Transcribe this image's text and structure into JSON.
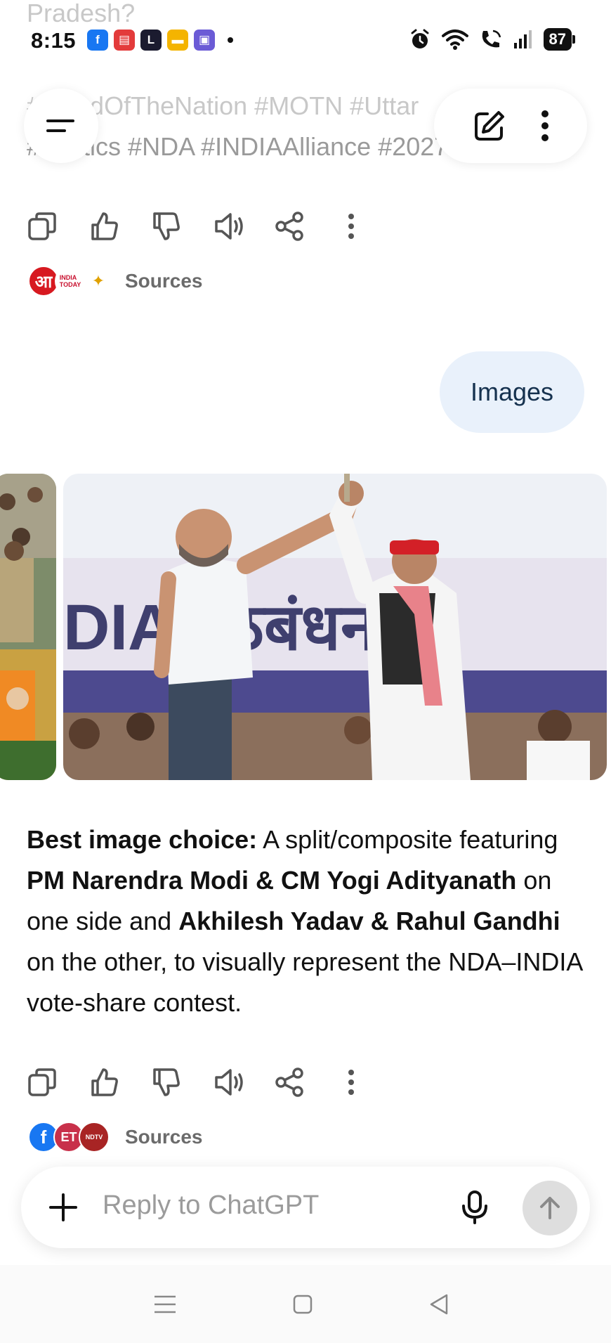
{
  "status_bar": {
    "time": "8:15",
    "battery": "87",
    "app_icons": [
      {
        "name": "facebook-app-icon",
        "glyph": "f",
        "color": "#1877f2"
      },
      {
        "name": "news-app-icon",
        "glyph": "▤",
        "color": "#e33b3b"
      },
      {
        "name": "news-l-app-icon",
        "glyph": "L",
        "color": "#1b1b2f"
      },
      {
        "name": "notes-app-icon",
        "glyph": "▬",
        "color": "#f4b400"
      },
      {
        "name": "gallery-app-icon",
        "glyph": "▣",
        "color": "#6b5bd6"
      }
    ]
  },
  "faded_text": {
    "line1": "Pradesh?",
    "line2": "#MoodOfTheNation #MOTN #Uttar",
    "line3": "#Politics #NDA #INDIAAlliance #2027"
  },
  "actions": {
    "copy": "copy-icon",
    "like": "thumbs-up-icon",
    "dislike": "thumbs-down-icon",
    "read_aloud": "speaker-icon",
    "share": "share-icon",
    "more": "more-vertical-icon"
  },
  "sources_top": {
    "label": "Sources",
    "logos": [
      {
        "name": "aaj-tak-logo",
        "text": "आ",
        "color": "#d71920"
      },
      {
        "name": "india-today-logo",
        "text": "INDIA TODAY",
        "color": "#c8102e"
      },
      {
        "name": "national-poster-logo",
        "text": "✦",
        "color": "#e0a100"
      }
    ]
  },
  "user_message": "Images",
  "answer": {
    "seg1_bold": "Best image choice:",
    "seg2": " A split/composite featuring ",
    "seg3_bold": "PM Narendra Modi & CM Yogi Adityanath",
    "seg4": " on one side and ",
    "seg5_bold": "Akhilesh Yadav & Rahul Gandhi",
    "seg6": " on the other, to visually represent the NDA–INDIA vote-share contest."
  },
  "sources_bottom": {
    "label": "Sources",
    "logos": [
      {
        "name": "facebook-source-logo",
        "text": "f",
        "color": "#1877f2"
      },
      {
        "name": "et-source-logo",
        "text": "ET",
        "color": "#c8102e"
      },
      {
        "name": "ndtv-source-logo",
        "text": "NDTV",
        "color": "#b71c1c"
      }
    ]
  },
  "composer": {
    "placeholder": "Reply to ChatGPT"
  },
  "image_banner_text": "DIA गठबंधन के"
}
